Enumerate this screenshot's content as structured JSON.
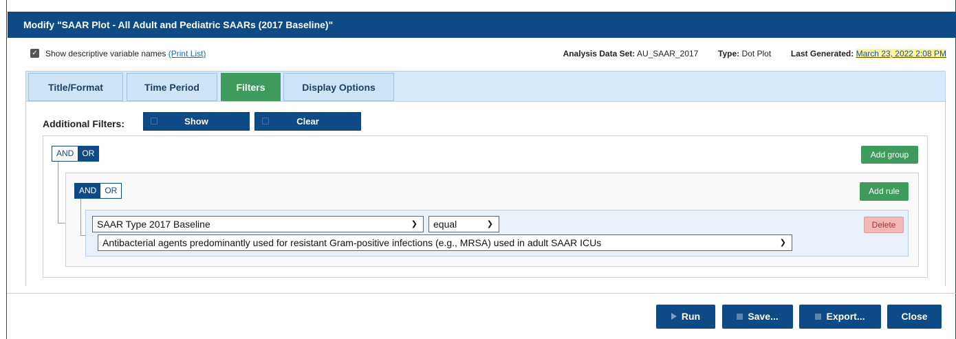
{
  "dialog": {
    "title": "Modify \"SAAR Plot - All Adult and Pediatric SAARs (2017 Baseline)\""
  },
  "meta": {
    "show_descriptive_label": "Show descriptive variable names",
    "print_list_link": "(Print List)",
    "checkbox_checked": true,
    "analysis_data_set_label": "Analysis Data Set:",
    "analysis_data_set_value": "AU_SAAR_2017",
    "type_label": "Type:",
    "type_value": "Dot Plot",
    "last_generated_label": "Last Generated:",
    "last_generated_value": "March 23, 2022 2:08 PM"
  },
  "tabs": [
    {
      "label": "Title/Format",
      "active": false
    },
    {
      "label": "Time Period",
      "active": false
    },
    {
      "label": "Filters",
      "active": true
    },
    {
      "label": "Display Options",
      "active": false
    }
  ],
  "filters": {
    "additional_filters_label": "Additional Filters:",
    "show_label": "Show",
    "clear_label": "Clear",
    "outer_group": {
      "and_label": "AND",
      "or_label": "OR",
      "selected": "OR",
      "add_group_label": "Add group"
    },
    "inner_group": {
      "and_label": "AND",
      "or_label": "OR",
      "selected": "AND",
      "add_rule_label": "Add rule"
    },
    "rule": {
      "field_value": "SAAR Type 2017 Baseline",
      "operator_value": "equal",
      "value_value": "Antibacterial agents predominantly used for resistant Gram-positive infections (e.g., MRSA) used in adult SAAR ICUs",
      "delete_label": "Delete"
    }
  },
  "footer": {
    "run_label": "Run",
    "save_label": "Save...",
    "export_label": "Export...",
    "close_label": "Close"
  },
  "colors": {
    "primary": "#0d4a86",
    "success": "#3e9b5c",
    "danger_light": "#f2b8b8",
    "tab_bg": "#d6e9f8",
    "highlight": "#fff59a"
  }
}
